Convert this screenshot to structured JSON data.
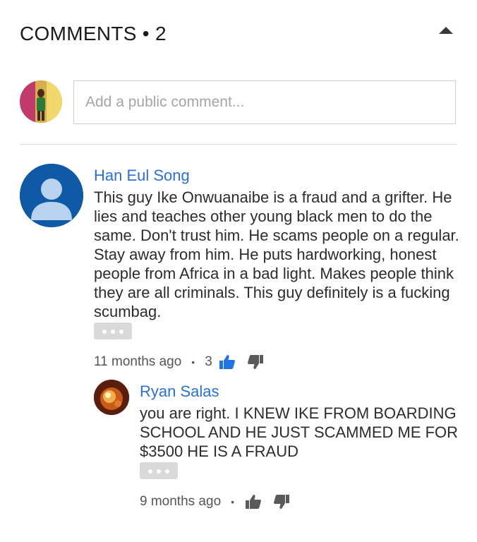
{
  "header": {
    "title": "COMMENTS • 2"
  },
  "composer": {
    "placeholder": "Add a public comment..."
  },
  "comments": [
    {
      "author": "Han Eul Song",
      "text": "This guy Ike Onwuanaibe is a fraud and a grifter. He lies and teaches other young black men to do the same. Don't trust him. He scams people on a regular. Stay away from him. He puts hardworking, honest people from Africa in a bad light. Makes people think they are all criminals. This guy definitely is a fucking scumbag.",
      "time": "11 months ago",
      "likes": "3",
      "liked": true
    },
    {
      "author": "Ryan Salas",
      "text": "you are right. I KNEW IKE FROM BOARDING SCHOOL AND HE JUST SCAMMED ME FOR $3500 HE IS A FRAUD",
      "time": "9 months ago",
      "likes": "",
      "liked": false
    }
  ],
  "colors": {
    "accent_blue": "#2a6fe0",
    "avatar_blue": "#0f5aa6",
    "like_active": "#1f73e6",
    "icon_gray": "#5a5a5a"
  },
  "icons": {
    "collapse": "chevron-up-icon",
    "like": "thumbs-up-icon",
    "dislike": "thumbs-down-icon",
    "more": "ellipsis-icon"
  }
}
